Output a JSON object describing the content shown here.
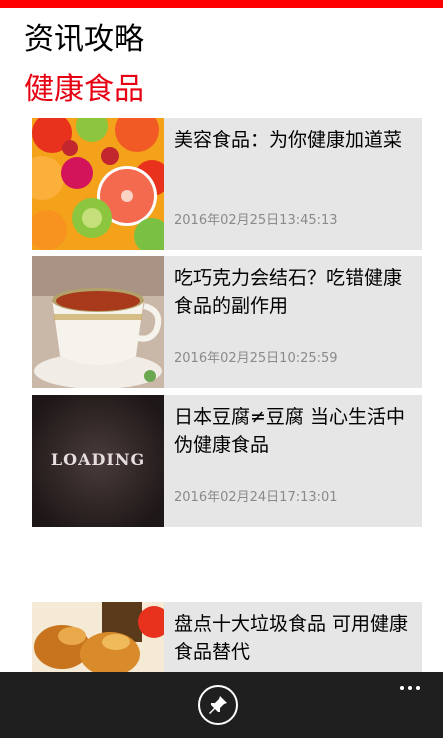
{
  "header": {
    "app_title": "资讯攻略",
    "section_title": "健康食品",
    "accent_color": "#e60012",
    "top_bar_color": "#ff0000"
  },
  "articles": [
    {
      "title": "美容食品：为你健康加道菜",
      "date": "2016年02月25日13:45:13",
      "thumbnail": "fruits-image"
    },
    {
      "title": "吃巧克力会结石？吃错健康食品的副作用",
      "date": "2016年02月25日10:25:59",
      "thumbnail": "tea-cup-image"
    },
    {
      "title": "日本豆腐≠豆腐 当心生活中伪健康食品",
      "date": "2016年02月24日17:13:01",
      "thumbnail": "loading-image",
      "thumbnail_text": "LOADING"
    },
    {
      "title": "盘点十大垃圾食品 可用健康食品替代",
      "date": "",
      "thumbnail": "fried-chicken-image"
    }
  ],
  "app_bar": {
    "pin_icon": "pin-icon",
    "more_icon": "more-icon"
  }
}
